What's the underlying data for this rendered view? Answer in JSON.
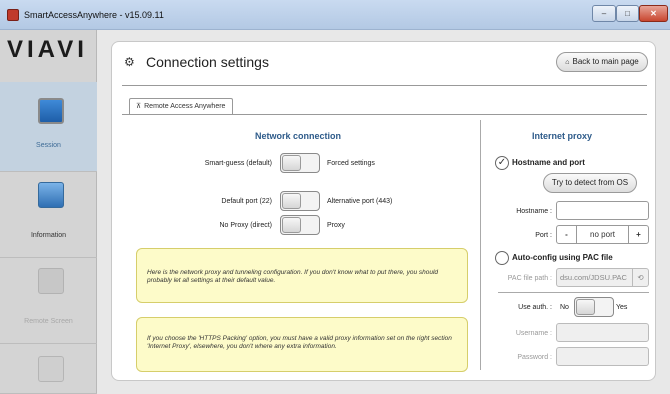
{
  "window": {
    "title": "SmartAccessAnywhere - v15.09.11",
    "min": "–",
    "max": "□",
    "close": "✕"
  },
  "sidebar": {
    "logo": "VIAVI",
    "items": [
      {
        "label": "Session",
        "icon": "monitor-icon",
        "state": "active"
      },
      {
        "label": "Information",
        "icon": "info-icon",
        "state": "normal"
      },
      {
        "label": "Remote Screen",
        "icon": "remote-screen-icon",
        "state": "disabled"
      },
      {
        "label": "",
        "icon": "transfer-icon",
        "state": "disabled"
      }
    ]
  },
  "header": {
    "title": "Connection settings",
    "gear_icon": "⚙",
    "back_label": "Back to main page",
    "back_icon": "⌂"
  },
  "tab": {
    "label": "Remote Access Anywhere",
    "icon": "⊼"
  },
  "network": {
    "title": "Network connection",
    "toggles": [
      {
        "left": "Smart-guess (default)",
        "right": "Forced settings",
        "state": "left"
      },
      {
        "left": "Default port (22)",
        "right": "Alternative port (443)",
        "state": "left"
      },
      {
        "left": "No Proxy (direct)",
        "right": "Proxy",
        "state": "left"
      }
    ],
    "note1": "Here is the network proxy and tunneling configuration. If you don't know what to put there, you should probably let all settings at their default value.",
    "note2": "If you choose the 'HTTPS Packing' option, you must have a valid proxy information set on the right section 'Internet Proxy', elsewhere, you don't where any extra information."
  },
  "proxy": {
    "title": "Internet proxy",
    "opt_hostname": "Hostname and port",
    "opt_hostname_checked": true,
    "detect_btn": "Try to detect from OS",
    "hostname_label": "Hostname :",
    "hostname_value": "",
    "port_label": "Port :",
    "port_minus": "-",
    "port_value": "no port",
    "port_plus": "+",
    "opt_pac": "Auto-config using PAC file",
    "opt_pac_checked": false,
    "pac_label": "PAC file path :",
    "pac_value": "dsu.com/JDSU.PAC",
    "pac_refresh": "⟲",
    "auth_label": "Use auth. :",
    "auth_no": "No",
    "auth_yes": "Yes",
    "auth_state": "left",
    "username_label": "Username :",
    "password_label": "Password :"
  }
}
